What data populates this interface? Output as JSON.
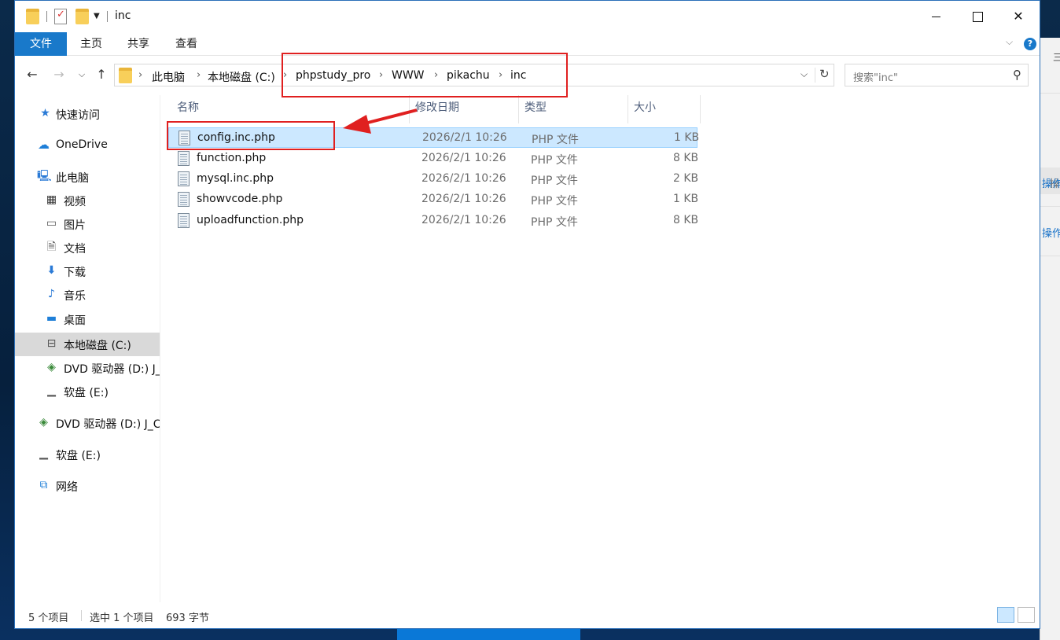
{
  "window": {
    "title": "inc",
    "controls": {
      "minimize": "",
      "maximize": "",
      "close": "✕"
    }
  },
  "ribbon": {
    "tabs": [
      "文件",
      "主页",
      "共享",
      "查看"
    ],
    "help": "?"
  },
  "address": {
    "crumbs": [
      "此电脑",
      "本地磁盘 (C:)",
      "phpstudy_pro",
      "WWW",
      "pikachu",
      "inc"
    ],
    "search_placeholder": "搜索\"inc\""
  },
  "nav": {
    "items": [
      {
        "label": "快速访问",
        "icon": "star-icon"
      },
      {
        "label": "OneDrive",
        "icon": "cloud-icon"
      },
      {
        "label": "此电脑",
        "icon": "computer-icon"
      },
      {
        "label": "视频",
        "icon": "video-icon"
      },
      {
        "label": "图片",
        "icon": "picture-icon"
      },
      {
        "label": "文档",
        "icon": "document-icon"
      },
      {
        "label": "下载",
        "icon": "download-icon"
      },
      {
        "label": "音乐",
        "icon": "music-icon"
      },
      {
        "label": "桌面",
        "icon": "desktop-icon"
      },
      {
        "label": "本地磁盘 (C:)",
        "icon": "drive-icon"
      },
      {
        "label": "DVD 驱动器 (D:) J_",
        "icon": "dvd-icon"
      },
      {
        "label": "软盘 (E:)",
        "icon": "floppy-icon"
      },
      {
        "label": "DVD 驱动器 (D:) J_C",
        "icon": "dvd-icon"
      },
      {
        "label": "软盘 (E:)",
        "icon": "floppy-icon"
      },
      {
        "label": "网络",
        "icon": "network-icon"
      }
    ]
  },
  "columns": [
    "名称",
    "修改日期",
    "类型",
    "大小"
  ],
  "files": [
    {
      "name": "config.inc.php",
      "date": "2026/2/1 10:26",
      "type": "PHP 文件",
      "size": "1 KB",
      "selected": true
    },
    {
      "name": "function.php",
      "date": "2026/2/1 10:26",
      "type": "PHP 文件",
      "size": "8 KB",
      "selected": false
    },
    {
      "name": "mysql.inc.php",
      "date": "2026/2/1 10:26",
      "type": "PHP 文件",
      "size": "2 KB",
      "selected": false
    },
    {
      "name": "showvcode.php",
      "date": "2026/2/1 10:26",
      "type": "PHP 文件",
      "size": "1 KB",
      "selected": false
    },
    {
      "name": "uploadfunction.php",
      "date": "2026/2/1 10:26",
      "type": "PHP 文件",
      "size": "8 KB",
      "selected": false
    }
  ],
  "status": {
    "count": "5 个项目",
    "selected": "选中 1 个项目",
    "size": "693 字节"
  },
  "background_window": {
    "glyph": "三",
    "label_grey": "操",
    "label_blue_1": "操作",
    "label_blue_2": "操作"
  },
  "colors": {
    "accent": "#1979ca",
    "selection": "#cce8ff",
    "annotation": "#e02020"
  }
}
